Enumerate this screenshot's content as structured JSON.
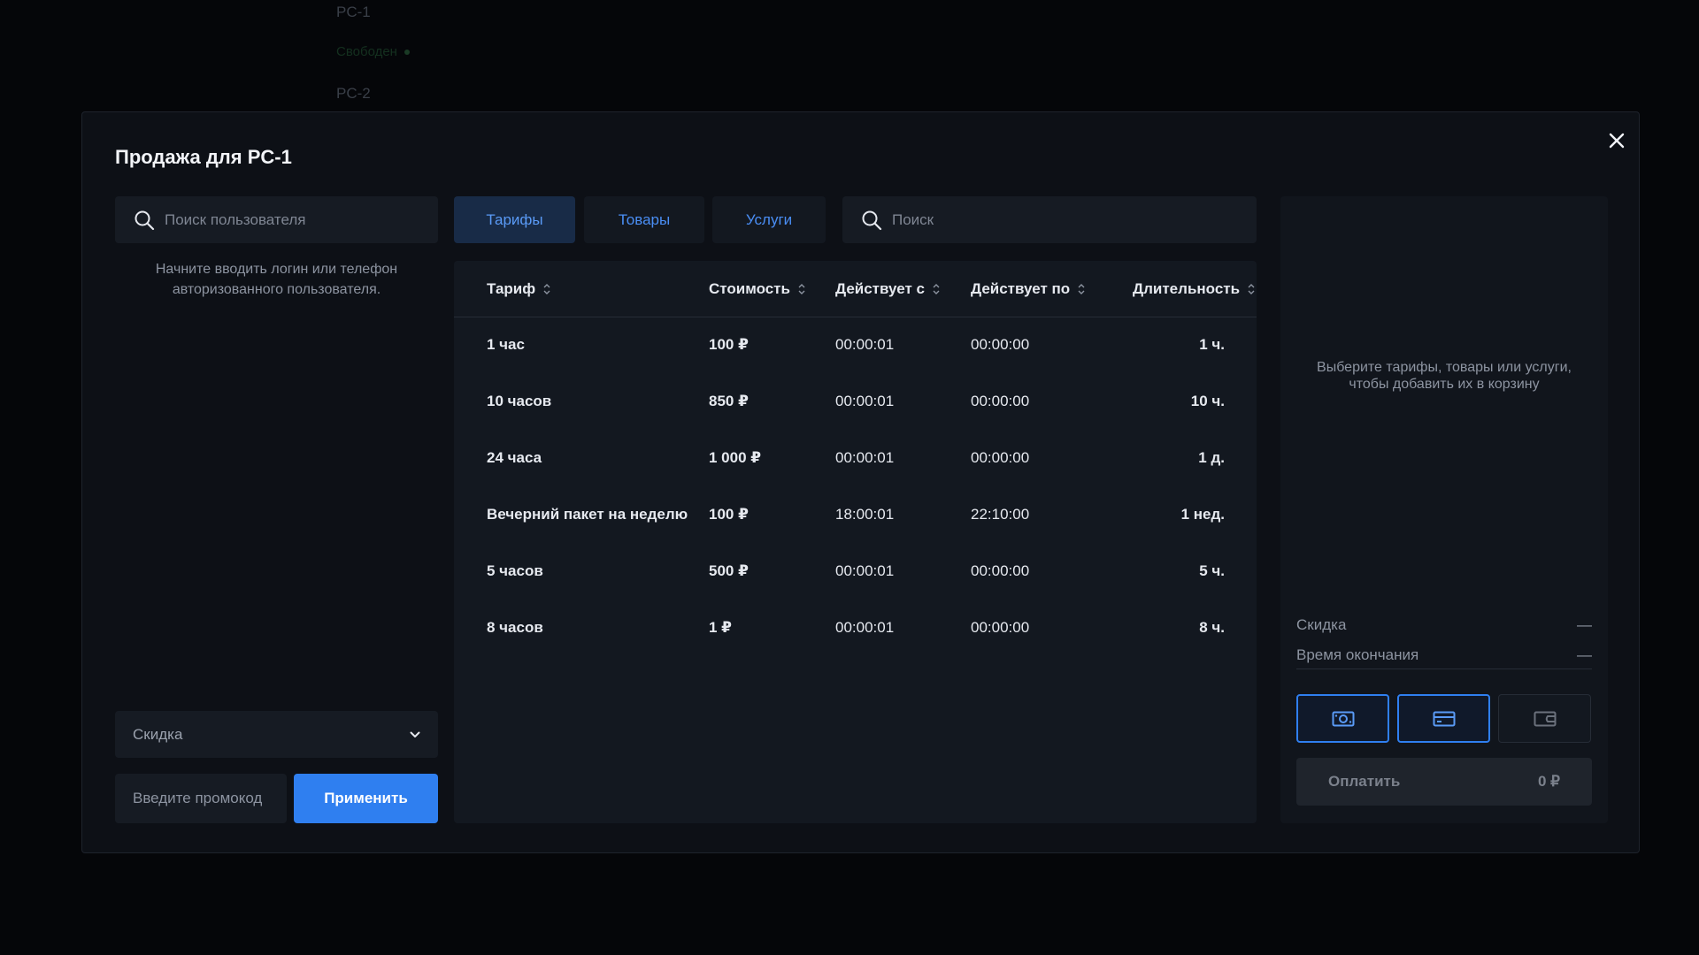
{
  "background": {
    "items": [
      {
        "label": "PC-1"
      },
      {
        "label": "PC-2"
      }
    ],
    "status": "Свободен"
  },
  "modal": {
    "title": "Продажа для PC-1",
    "close_icon": "close-icon"
  },
  "user_search": {
    "placeholder": "Поиск пользователя",
    "hint": "Начните вводить логин или телефон авторизованного пользователя."
  },
  "discount": {
    "label": "Скидка"
  },
  "promo": {
    "placeholder": "Введите промокод",
    "apply_label": "Применить"
  },
  "tabs": [
    {
      "label": "Тарифы",
      "active": true
    },
    {
      "label": "Товары",
      "active": false
    },
    {
      "label": "Услуги",
      "active": false
    }
  ],
  "search": {
    "placeholder": "Поиск"
  },
  "table": {
    "columns": [
      "Тариф",
      "Стоимость",
      "Действует с",
      "Действует по",
      "Длительность"
    ],
    "rows": [
      {
        "name": "1 час",
        "price": "100 ₽",
        "from": "00:00:01",
        "to": "00:00:00",
        "duration": "1 ч."
      },
      {
        "name": "10 часов",
        "price": "850 ₽",
        "from": "00:00:01",
        "to": "00:00:00",
        "duration": "10 ч."
      },
      {
        "name": "24 часа",
        "price": "1 000 ₽",
        "from": "00:00:01",
        "to": "00:00:00",
        "duration": "1 д."
      },
      {
        "name": "Вечерний пакет на неделю",
        "price": "100 ₽",
        "from": "18:00:01",
        "to": "22:10:00",
        "duration": "1 нед."
      },
      {
        "name": "5 часов",
        "price": "500 ₽",
        "from": "00:00:01",
        "to": "00:00:00",
        "duration": "5 ч."
      },
      {
        "name": "8 часов",
        "price": "1 ₽",
        "from": "00:00:01",
        "to": "00:00:00",
        "duration": "8 ч."
      }
    ]
  },
  "cart": {
    "hint": "Выберите тарифы, товары или услуги, чтобы добавить их в корзину",
    "discount_label": "Скидка",
    "discount_value": "—",
    "end_time_label": "Время окончания",
    "end_time_value": "—",
    "payment_methods": [
      {
        "icon": "cash-icon",
        "selected": true
      },
      {
        "icon": "card-icon",
        "selected": true
      },
      {
        "icon": "wallet-icon",
        "selected": false
      }
    ],
    "pay_label": "Оплатить",
    "pay_amount": "0 ₽"
  },
  "colors": {
    "accent": "#2f7ff0",
    "background": "#0d1016",
    "panel": "#131820"
  }
}
